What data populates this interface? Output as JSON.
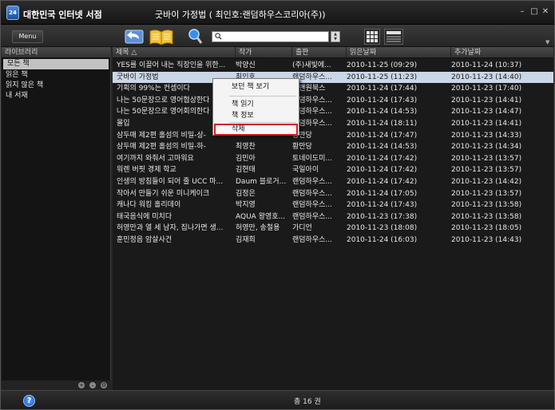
{
  "app": {
    "logo_text": "24",
    "name": "대한민국 인터넷 서점",
    "window_title": "굿바이 가정법 ( 최인호:랜덤하우스코리아(주))"
  },
  "toolbar": {
    "menu_label": "Menu",
    "search": {
      "value": "",
      "placeholder": ""
    }
  },
  "sidebar": {
    "header": "라이브러리",
    "items": [
      {
        "label": "모든 책",
        "selected": true
      },
      {
        "label": "읽은 책",
        "selected": false
      },
      {
        "label": "읽지 않은 책",
        "selected": false
      },
      {
        "label": "내 서재",
        "selected": false
      }
    ]
  },
  "table": {
    "columns": [
      "제목 △",
      "작가",
      "출판",
      "읽은날짜",
      "추가날짜"
    ],
    "rows": [
      [
        "YES를 이끌어 내는 직장인을 위한...",
        "박양신",
        "(주)새빛에...",
        "2010-11-25 (09:29)",
        "2010-11-24 (10:37)"
      ],
      [
        "굿바이 가정법",
        "최인호",
        "랜덤하우스...",
        "2010-11-25 (11:23)",
        "2010-11-23 (14:40)"
      ],
      [
        "기획의 99%는 컨셉이다",
        "",
        "드앤원북스",
        "2010-11-24 (17:44)",
        "2010-11-23 (17:40)"
      ],
      [
        "나는 50문장으로 영어협상한다",
        "",
        "랜덤하우스...",
        "2010-11-24 (17:43)",
        "2010-11-23 (14:41)"
      ],
      [
        "나는 50문장으로 영어회의한다",
        "",
        "랜덤하우스...",
        "2010-11-24 (14:53)",
        "2010-11-23 (14:47)"
      ],
      [
        "몰입",
        "",
        "랜덤하우스...",
        "2010-11-24 (18:11)",
        "2010-11-23 (14:41)"
      ],
      [
        "삼두매 제2편 홀섬의 비밀-상-",
        "",
        "황만당",
        "2010-11-24 (17:47)",
        "2010-11-23 (14:33)"
      ],
      [
        "삼두매 제2편 홀섬의 비밀-하-",
        "최영찬",
        "황만당",
        "2010-11-24 (14:53)",
        "2010-11-23 (14:34)"
      ],
      [
        "여기까지 와줘서 고마워요",
        "김민아",
        "토네이도미...",
        "2010-11-24 (17:42)",
        "2010-11-23 (13:57)"
      ],
      [
        "워렌 버핏 경제 학교",
        "김현태",
        "국일아이",
        "2010-11-24 (17:42)",
        "2010-11-23 (13:57)"
      ],
      [
        "인생의 방침들이 되어 줄 UCC 마...",
        "Daum 블로거...",
        "랜덤하우스...",
        "2010-11-24 (17:42)",
        "2010-11-23 (14:42)"
      ],
      [
        "작아서 만들기 쉬운 미니케이크",
        "김정은",
        "랜덤하우스...",
        "2010-11-24 (17:05)",
        "2010-11-23 (13:57)"
      ],
      [
        "캐나다 워킹 홀리데이",
        "박지영",
        "랜덤하우스...",
        "2010-11-24 (17:43)",
        "2010-11-23 (13:58)"
      ],
      [
        "태국음식에 미치다",
        "AQUA 왕영호...",
        "랜덤하우스...",
        "2010-11-23 (17:38)",
        "2010-11-23 (13:58)"
      ],
      [
        "허영만과 열 세 남자, 집나가면 생...",
        "허영만, 송철용",
        "가디언",
        "2010-11-23 (18:08)",
        "2010-11-23 (18:05)"
      ],
      [
        "훈민정음 암살사건",
        "김재희",
        "랜덤하우스...",
        "2010-11-24 (16:03)",
        "2010-11-23 (14:43)"
      ]
    ],
    "selected_row": 1
  },
  "context_menu": {
    "items": [
      "보던 책 보기",
      "책 읽기",
      "책 정보",
      "삭제"
    ]
  },
  "status": {
    "count": "총 16 권",
    "help": "?"
  },
  "colors": {
    "selection": "#cbd6e6",
    "highlight_border": "#d02020"
  }
}
